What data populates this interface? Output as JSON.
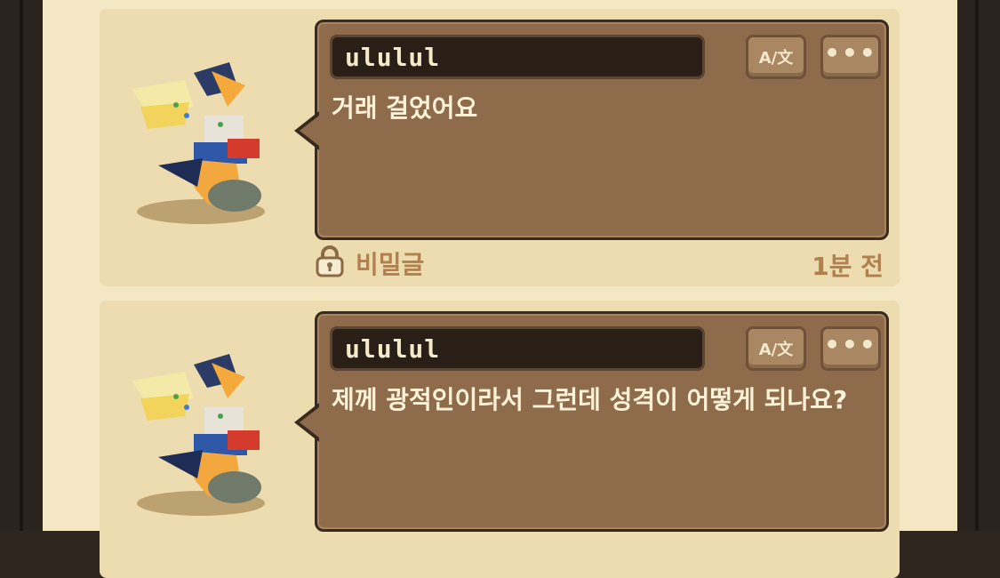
{
  "posts": [
    {
      "author": "ululul",
      "message": "거래 걸었어요",
      "translate_label": "A/文",
      "more_label": "•••",
      "secret_label": "비밀글",
      "time": "1분 전"
    },
    {
      "author": "ululul",
      "message": "제께 광적인이라서 그런데 성격이 어떻게 되나요?",
      "translate_label": "A/文",
      "more_label": "•••"
    }
  ]
}
